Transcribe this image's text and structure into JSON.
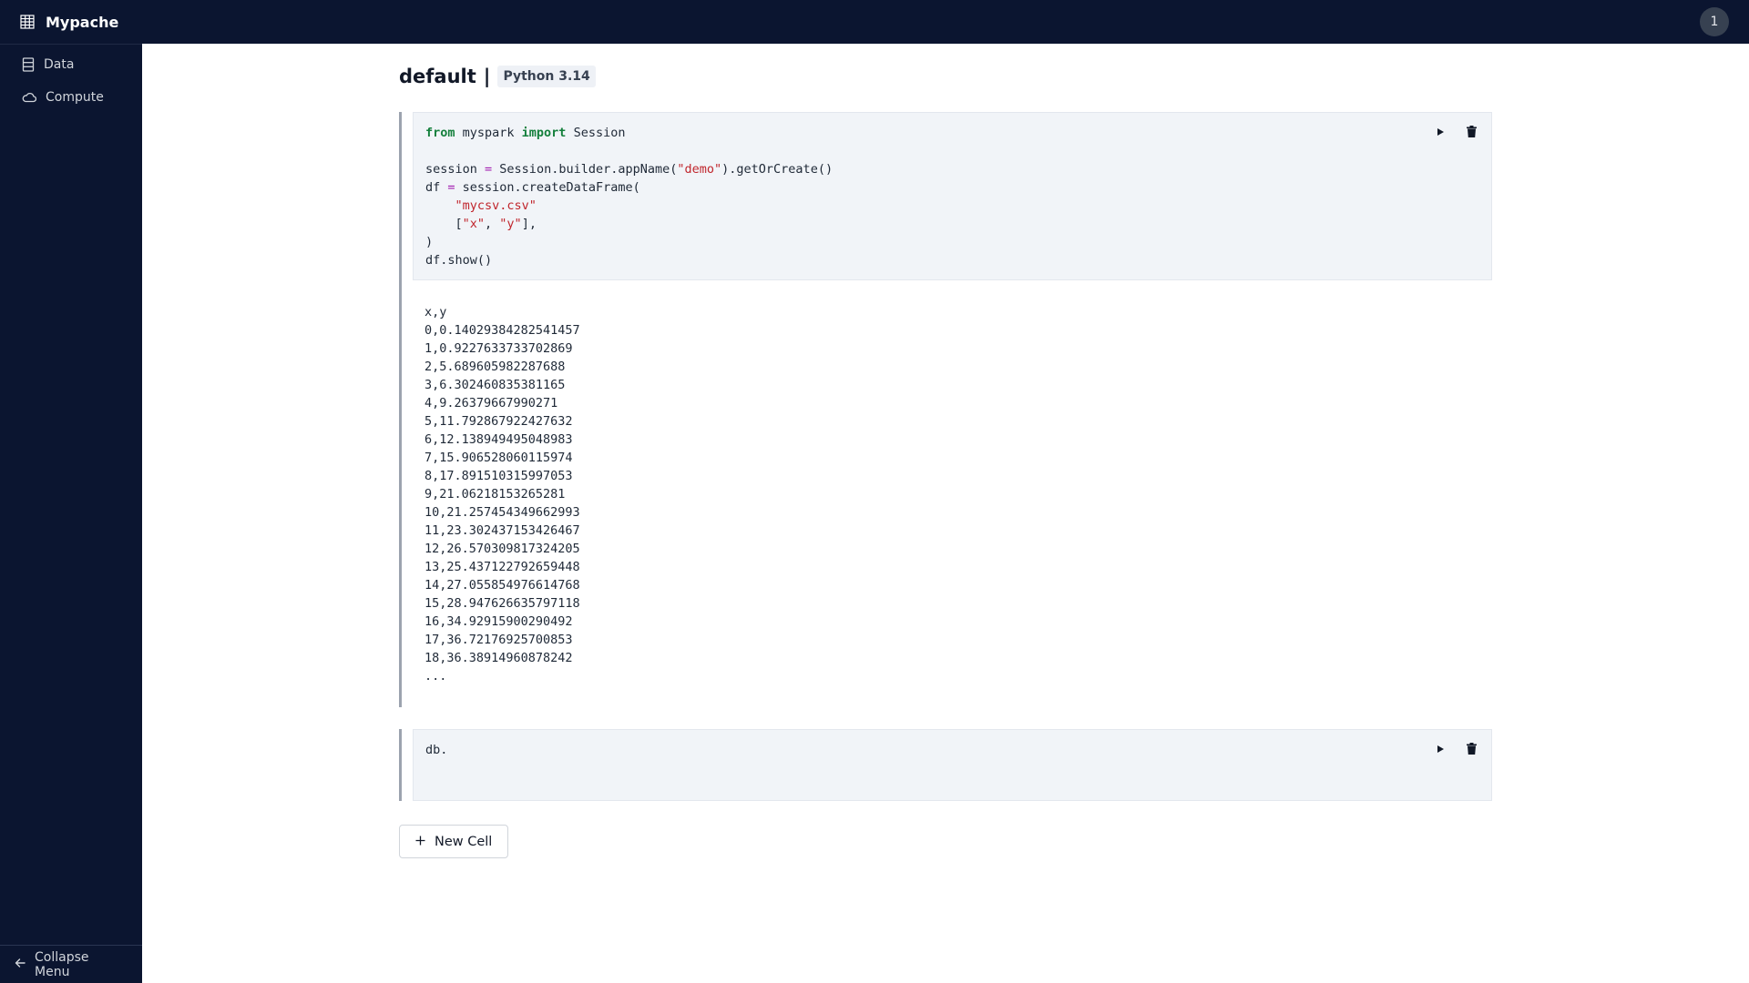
{
  "app": {
    "brand": "Mypache",
    "user_badge": "1"
  },
  "sidebar": {
    "items": [
      {
        "label": "Data",
        "icon": "database-icon"
      },
      {
        "label": "Compute",
        "icon": "cloud-icon"
      }
    ],
    "collapse_label": "Collapse Menu"
  },
  "notebook": {
    "name": "default",
    "separator": "|",
    "kernel": "Python 3.14"
  },
  "cells": [
    {
      "code_lines": [
        [
          {
            "t": "from",
            "c": "kw"
          },
          {
            "t": " myspark "
          },
          {
            "t": "import",
            "c": "kw"
          },
          {
            "t": " Session"
          }
        ],
        [
          {
            "t": ""
          }
        ],
        [
          {
            "t": "session "
          },
          {
            "t": "=",
            "c": "op"
          },
          {
            "t": " Session.builder.appName("
          },
          {
            "t": "\"demo\"",
            "c": "str"
          },
          {
            "t": ").getOrCreate()"
          }
        ],
        [
          {
            "t": "df "
          },
          {
            "t": "=",
            "c": "op"
          },
          {
            "t": " session.createDataFrame("
          }
        ],
        [
          {
            "t": "    "
          },
          {
            "t": "\"mycsv.csv\"",
            "c": "str"
          }
        ],
        [
          {
            "t": "    ["
          },
          {
            "t": "\"x\"",
            "c": "str"
          },
          {
            "t": ", "
          },
          {
            "t": "\"y\"",
            "c": "str"
          },
          {
            "t": "],"
          }
        ],
        [
          {
            "t": ")"
          }
        ],
        [
          {
            "t": "df.show()"
          }
        ]
      ],
      "output_lines": [
        "x,y",
        "0,0.14029384282541457",
        "1,0.9227633733702869",
        "2,5.689605982287688",
        "3,6.302460835381165",
        "4,9.26379667990271",
        "5,11.792867922427632",
        "6,12.138949495048983",
        "7,15.906528060115974",
        "8,17.891510315997053",
        "9,21.06218153265281",
        "10,21.257454349662993",
        "11,23.302437153426467",
        "12,26.570309817324205",
        "13,25.437122792659448",
        "14,27.055854976614768",
        "15,28.947626635797118",
        "16,34.92915900290492",
        "17,36.72176925700853",
        "18,36.38914960878242",
        "..."
      ]
    },
    {
      "code_lines": [
        [
          {
            "t": "db."
          }
        ],
        [
          {
            "t": ""
          }
        ]
      ],
      "output_lines": []
    }
  ],
  "actions": {
    "run_icon": "play-icon",
    "delete_icon": "trash-icon",
    "new_cell_label": "New Cell"
  },
  "colors": {
    "topbar": "#0b1530",
    "code_bg": "#f1f4f8",
    "keyword": "#15803d",
    "string": "#c0262d",
    "operator": "#a21caf"
  }
}
